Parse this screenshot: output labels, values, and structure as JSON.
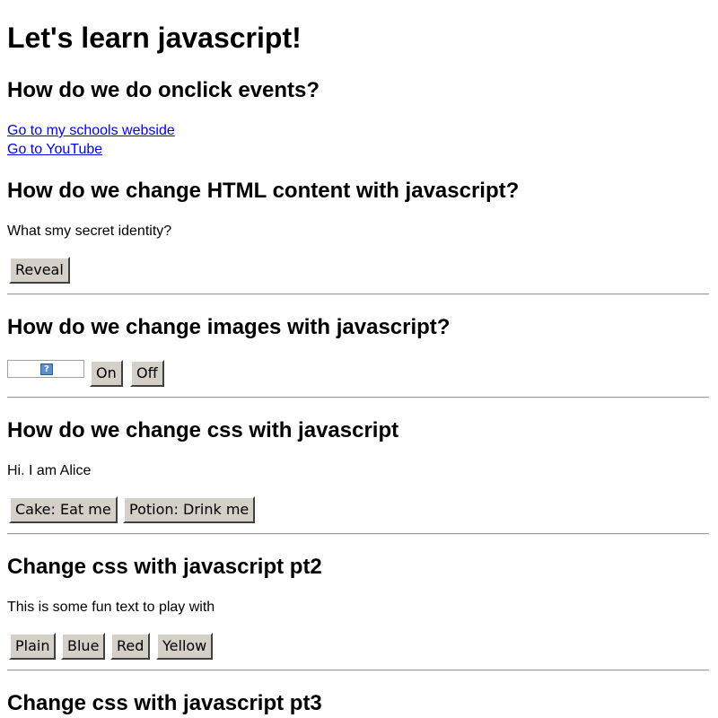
{
  "page": {
    "title": "Let's learn javascript!"
  },
  "onclick_section": {
    "heading": "How do we do onclick events?",
    "links": [
      "Go to my schools webside",
      "Go to YouTube"
    ]
  },
  "html_content_section": {
    "heading": "How do we change HTML content with javascript?",
    "text": "What smy secret identity?",
    "button": "Reveal"
  },
  "images_section": {
    "heading": "How do we change images with javascript?",
    "image_icon": "broken-image-icon",
    "buttons": [
      "On",
      "Off"
    ]
  },
  "css_section": {
    "heading": "How do we change css with javascript",
    "text": "Hi. I am Alice",
    "buttons": [
      "Cake: Eat me",
      "Potion: Drink me"
    ]
  },
  "css_pt2_section": {
    "heading": "Change css with javascript pt2",
    "text": "This is some fun text to play with",
    "buttons": [
      "Plain",
      "Blue",
      "Red",
      "Yellow"
    ]
  },
  "css_pt3_section": {
    "heading": "Change css with javascript pt3"
  },
  "colors": {
    "link": "#0000ee",
    "button_face": "#d4d0c8",
    "rule": "#9a9a9a"
  }
}
